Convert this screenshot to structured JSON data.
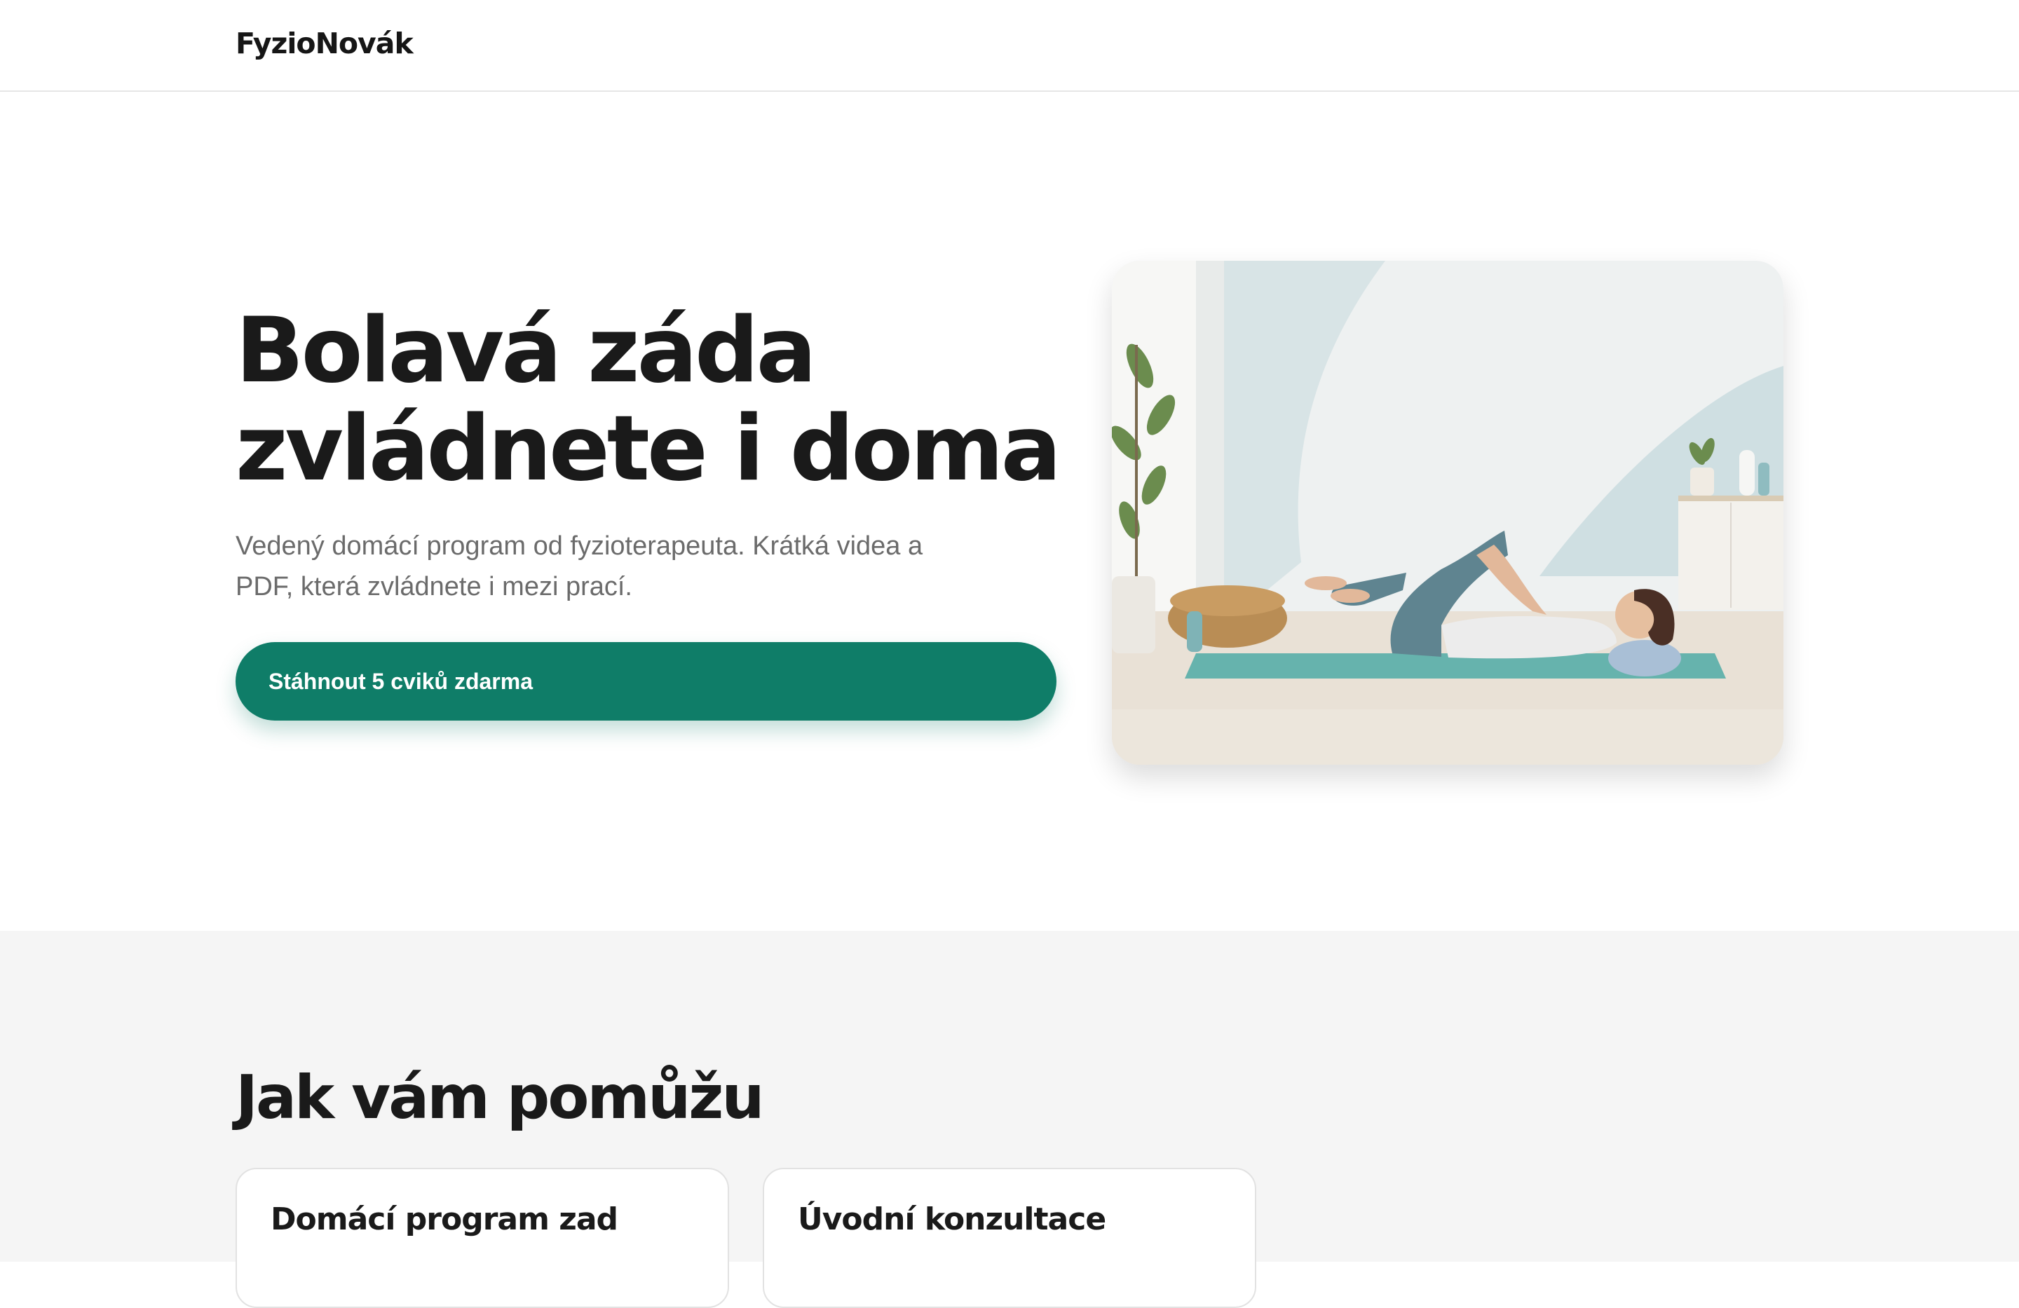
{
  "brand": {
    "name": "FyzioNovák"
  },
  "hero": {
    "title_line1": "Bolavá záda",
    "title_line2": "zvládnete i doma",
    "subtitle_line1": "Vedený domácí program od fyzioterapeuta. Krátká videa a",
    "subtitle_line2": "PDF, která zvládnete i mezi prací.",
    "cta_label": "Stáhnout 5 cviků zdarma"
  },
  "services": {
    "title": "Jak vám pomůžu",
    "cards": [
      {
        "title": "Domácí program zad"
      },
      {
        "title": "Úvodní konzultace"
      }
    ]
  },
  "colors": {
    "accent": "#0f7d68",
    "muted_text": "#6b6b6b",
    "section_bg": "#f5f5f5"
  }
}
